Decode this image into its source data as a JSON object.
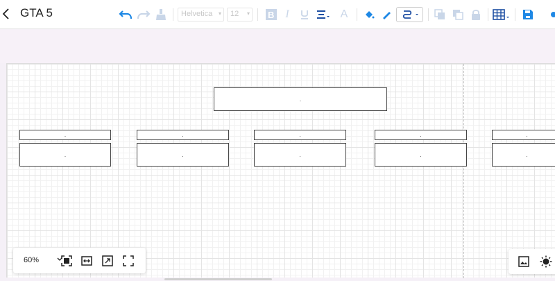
{
  "header": {
    "title": "GTA 5"
  },
  "toolbar": {
    "font_family": "Helvetica",
    "font_size": "12",
    "accent_color": "#1e88e5",
    "disabled_color": "#c9d6e8"
  },
  "diagram": {
    "root": {
      "label": "."
    },
    "children": [
      {
        "title": ".",
        "body": "."
      },
      {
        "title": ".",
        "body": "."
      },
      {
        "title": ".",
        "body": "."
      },
      {
        "title": ".",
        "body": "."
      },
      {
        "title": ".",
        "body": "."
      }
    ]
  },
  "zoom": {
    "level": "60%"
  }
}
